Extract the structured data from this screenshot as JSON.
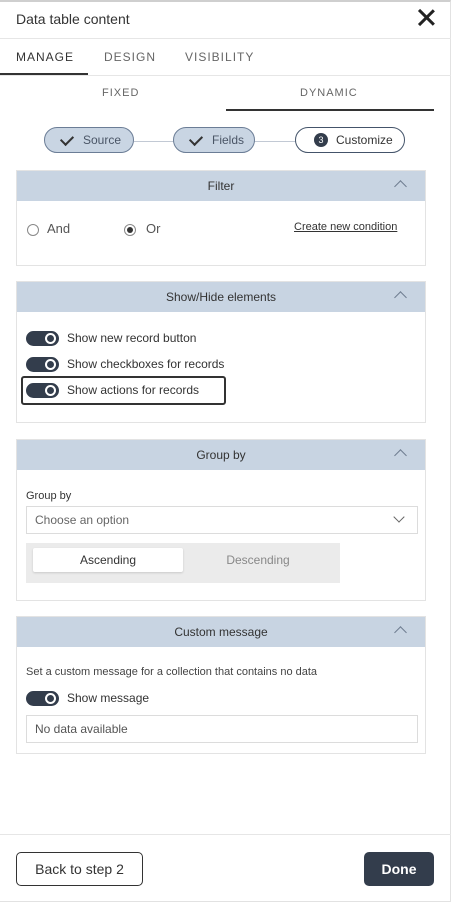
{
  "panel": {
    "title": "Data table content"
  },
  "tabs": [
    {
      "label": "MANAGE"
    },
    {
      "label": "DESIGN"
    },
    {
      "label": "VISIBILITY"
    }
  ],
  "subtabs": [
    {
      "label": "FIXED"
    },
    {
      "label": "DYNAMIC"
    }
  ],
  "steps": [
    {
      "label": "Source",
      "state": "done"
    },
    {
      "label": "Fields",
      "state": "done"
    },
    {
      "label": "Customize",
      "number": "3",
      "state": "current"
    }
  ],
  "filter": {
    "title": "Filter",
    "options": [
      {
        "label": "And",
        "selected": false
      },
      {
        "label": "Or",
        "selected": true
      }
    ],
    "create_link": "Create new condition"
  },
  "show_hide": {
    "title": "Show/Hide elements",
    "toggles": [
      {
        "label": "Show new record button",
        "on": true
      },
      {
        "label": "Show checkboxes for records",
        "on": true
      },
      {
        "label": "Show actions for records",
        "on": true
      }
    ]
  },
  "group_by": {
    "title": "Group by",
    "field_label": "Group by",
    "placeholder": "Choose an option",
    "sort": {
      "ascending": "Ascending",
      "descending": "Descending",
      "selected": "Ascending"
    }
  },
  "custom_message": {
    "title": "Custom message",
    "description": "Set a custom message for a collection that contains no data",
    "toggle_label": "Show message",
    "toggle_on": true,
    "value": "No data available"
  },
  "footer": {
    "back_label": "Back to step 2",
    "done_label": "Done"
  },
  "colors": {
    "section_header": "#c8d4e2",
    "primary_dark": "#333d4c"
  }
}
